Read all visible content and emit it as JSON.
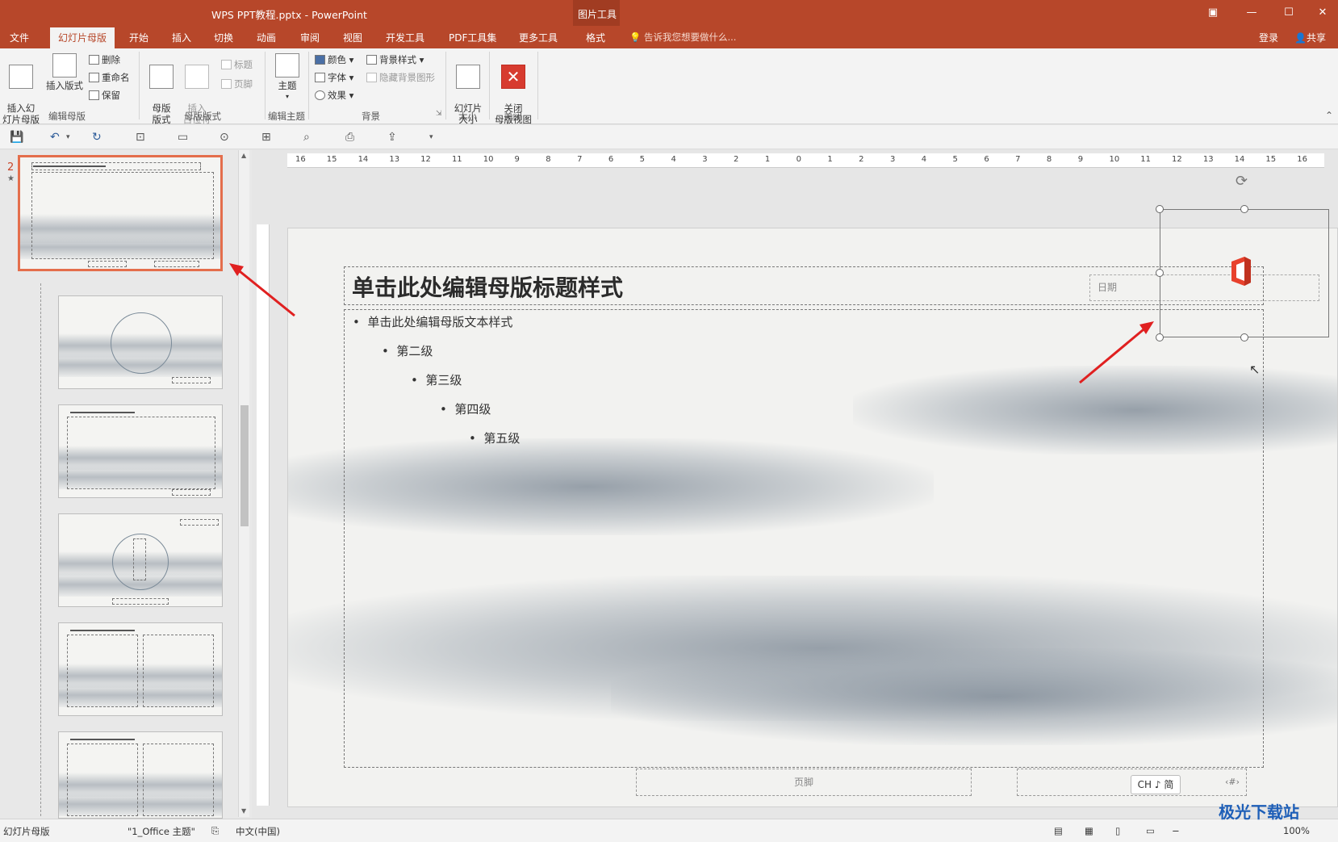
{
  "window": {
    "title": "WPS PPT教程.pptx - PowerPoint",
    "context_tab_group": "图片工具"
  },
  "tabs": [
    "文件",
    "幻灯片母版",
    "开始",
    "插入",
    "切换",
    "动画",
    "审阅",
    "视图",
    "开发工具",
    "PDF工具集",
    "更多工具",
    "格式"
  ],
  "tellme": "告诉我您想要做什么...",
  "account": {
    "login": "登录",
    "share": "共享"
  },
  "ribbon": {
    "edit_master": {
      "insert_slide_master": "插入幻\n灯片母版",
      "insert_layout": "插入版式",
      "delete": "删除",
      "rename": "重命名",
      "preserve": "保留",
      "label": "编辑母版"
    },
    "master_layout": {
      "master_layout_btn": "母版\n版式",
      "insert_placeholder": "插入\n占位符",
      "title_chk": "标题",
      "footer_chk": "页脚",
      "label": "母版版式"
    },
    "edit_theme": {
      "theme": "主题",
      "label": "编辑主题"
    },
    "background": {
      "colors": "颜色",
      "fonts": "字体",
      "effects": "效果",
      "bg_styles": "背景样式",
      "hide_bg": "隐藏背景图形",
      "label": "背景"
    },
    "size": {
      "slide_size": "幻灯片\n大小",
      "label": "大小"
    },
    "close": {
      "close_master": "关闭\n母版视图",
      "label": "关闭"
    }
  },
  "thumbnail": {
    "number": "2",
    "star": "★"
  },
  "slide": {
    "title": "单击此处编辑母版标题样式",
    "levels": [
      "单击此处编辑母版文本样式",
      "第二级",
      "第三级",
      "第四级",
      "第五级"
    ],
    "date": "日期",
    "footer": "页脚",
    "ime": "CH ♪ 简"
  },
  "ruler_labels": [
    "16",
    "15",
    "14",
    "13",
    "12",
    "11",
    "10",
    "9",
    "8",
    "7",
    "6",
    "5",
    "4",
    "3",
    "2",
    "1",
    "0",
    "1",
    "2",
    "3",
    "4",
    "5",
    "6",
    "7",
    "8",
    "9",
    "10",
    "11",
    "12",
    "13",
    "14",
    "15",
    "16"
  ],
  "status": {
    "view": "幻灯片母版",
    "theme": "\"1_Office 主题\"",
    "lang": "中文(中国)",
    "zoom": "100%"
  },
  "watermark": "极光下载站",
  "colors": {
    "brand": "#b7472a",
    "accent_selected": "#e46e4c"
  }
}
